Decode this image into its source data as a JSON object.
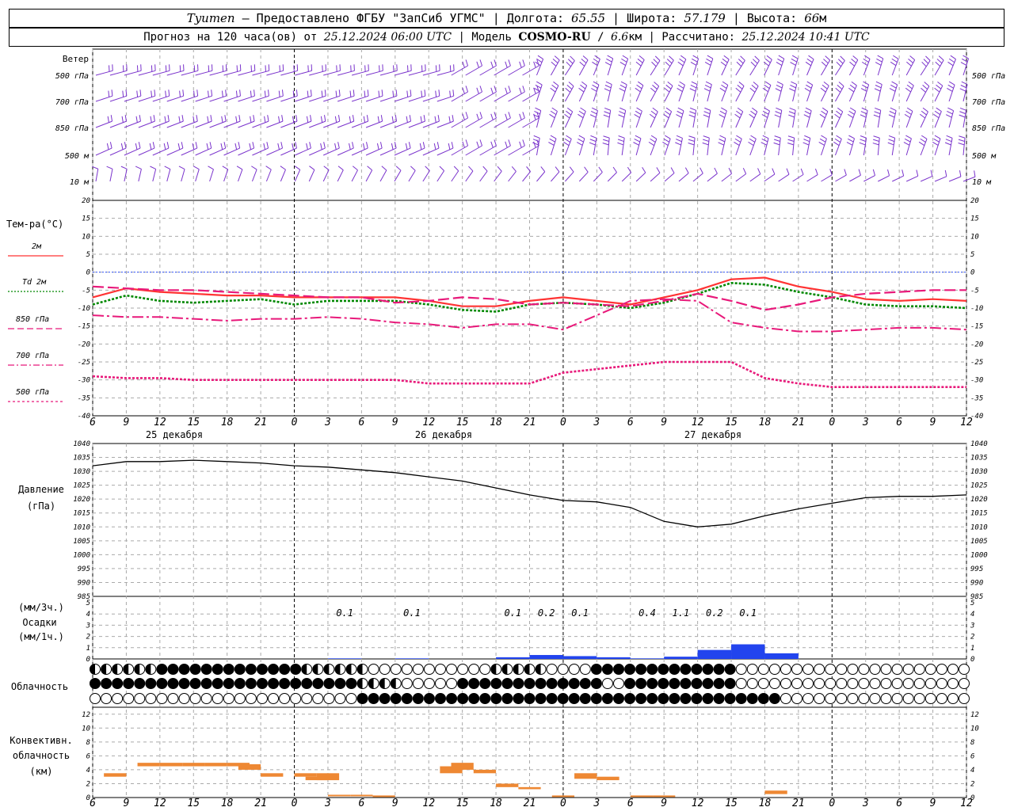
{
  "header": {
    "city": "Tyumen",
    "provider": " – Предоставлено ФГБУ \"ЗапСиб УГМС\" | Долгота: ",
    "lon": "65.55",
    "lat_label": " | Широта: ",
    "lat": "57.179",
    "alt_label": " | Высота: ",
    "alt": "66",
    "alt_unit": "м",
    "forecast_label": "Прогноз на 120 часа(ов) от ",
    "run_time": "25.12.2024 06:00 UTC",
    "model_label": "  | Модель ",
    "model": "COSMO-RU",
    "model_sep": " / ",
    "res": "6.6",
    "res_unit": "км",
    "calc_label": " | Рассчитано: ",
    "calc_time": "25.12.2024 10:41 UTC"
  },
  "wind_panel": {
    "title": "Ветер",
    "levels": [
      "500 гПа",
      "700 гПа",
      "850 гПа",
      "500 м",
      "10  м"
    ],
    "color": "#7a33cc"
  },
  "temp_panel": {
    "title": "Тем-ра(°С)",
    "legend": [
      {
        "label": "2м",
        "color": "#ff3333",
        "style": "solid"
      },
      {
        "label": "Td  2м",
        "color": "#008800",
        "style": "dotted"
      },
      {
        "label": "850 гПа",
        "color": "#e8197a",
        "style": "dash"
      },
      {
        "label": "700 гПа",
        "color": "#e8197a",
        "style": "dashdot"
      },
      {
        "label": "500 гПа",
        "color": "#e8197a",
        "style": "dot"
      }
    ],
    "ticks": [
      "20",
      "15",
      "10",
      "5",
      "0",
      "-5",
      "-10",
      "-15",
      "-20",
      "-25",
      "-30",
      "-35",
      "-40"
    ]
  },
  "time_axis": {
    "hours": [
      "6",
      "9",
      "12",
      "15",
      "18",
      "21",
      "0",
      "3",
      "6",
      "9",
      "12",
      "15",
      "18",
      "21",
      "0",
      "3",
      "6",
      "9",
      "12",
      "15",
      "18",
      "21",
      "0",
      "3",
      "6",
      "9",
      "12"
    ],
    "days": [
      "25 декабря",
      "26 декабря",
      "27 декабря"
    ]
  },
  "pressure_panel": {
    "title": "Давление",
    "unit": "(гПа)",
    "ticks": [
      "1040",
      "1035",
      "1030",
      "1025",
      "1020",
      "1015",
      "1010",
      "1005",
      "1000",
      "995",
      "990",
      "985"
    ]
  },
  "precip_panel": {
    "title1": "(мм/3ч.)",
    "title2": "Осадки",
    "title3": "(мм/1ч.)",
    "ticks": [
      "5",
      "4",
      "3",
      "2",
      "1",
      "0"
    ],
    "labels": [
      "0.1",
      "0.1",
      "0.1",
      "0.2",
      "0.1",
      "0.4",
      "1.1",
      "0.2",
      "0.1"
    ],
    "color": "#2244ee"
  },
  "cloud_panel": {
    "title": "Облачность"
  },
  "conv_panel": {
    "title1": "Конвективн.",
    "title2": "облачность",
    "title3": "(км)",
    "ticks": [
      "12",
      "10",
      "8",
      "6",
      "4",
      "2",
      "0"
    ],
    "color": "#ee8833"
  },
  "chart_data": [
    {
      "type": "line",
      "title": "Тем-ра(°С)",
      "x_hours_from_start": [
        0,
        3,
        6,
        9,
        12,
        15,
        18,
        21,
        24,
        27,
        30,
        33,
        36,
        39,
        42,
        45,
        48,
        51,
        54,
        57,
        60,
        63,
        66,
        69,
        72,
        75,
        78
      ],
      "ylim": [
        -40,
        20
      ],
      "series": [
        {
          "name": "2м",
          "values": [
            -7,
            -4.5,
            -5.5,
            -6,
            -6.5,
            -6.5,
            -7,
            -7,
            -7,
            -7,
            -8,
            -9.5,
            -9.5,
            -8,
            -7,
            -8,
            -9,
            -7,
            -5,
            -2,
            -1.5,
            -4,
            -5.5,
            -7.5,
            -8,
            -7.5,
            -8
          ]
        },
        {
          "name": "Td 2м",
          "values": [
            -9,
            -6.5,
            -8,
            -8.5,
            -8,
            -7.5,
            -9,
            -8,
            -8,
            -8,
            -9,
            -10.5,
            -11,
            -9,
            -8.5,
            -9,
            -10,
            -8.5,
            -6,
            -3,
            -3.5,
            -5.5,
            -7,
            -9,
            -9.5,
            -9.5,
            -10
          ]
        },
        {
          "name": "850 гПа",
          "values": [
            -4,
            -4.5,
            -5,
            -5,
            -5.5,
            -6,
            -6.5,
            -7,
            -7,
            -8.5,
            -8,
            -7,
            -7.5,
            -9,
            -8.5,
            -9,
            -9.5,
            -8,
            -6,
            -8,
            -10.5,
            -9,
            -7,
            -6,
            -5.5,
            -5,
            -5
          ]
        },
        {
          "name": "700 гПа",
          "values": [
            -12,
            -12.5,
            -12.5,
            -13,
            -13.5,
            -13,
            -13,
            -12.5,
            -13,
            -14,
            -14.5,
            -15.5,
            -14.5,
            -14.5,
            -16,
            -12,
            -8,
            -7.5,
            -8,
            -14,
            -15.5,
            -16.5,
            -16.5,
            -16,
            -15.5,
            -15.5,
            -16
          ]
        },
        {
          "name": "500 гПа",
          "values": [
            -29,
            -29.5,
            -29.5,
            -30,
            -30,
            -30,
            -30,
            -30,
            -30,
            -30,
            -31,
            -31,
            -31,
            -31,
            -28,
            -27,
            -26,
            -25,
            -25,
            -25,
            -29.5,
            -31,
            -32,
            -32,
            -32,
            -32,
            -32
          ]
        }
      ]
    },
    {
      "type": "line",
      "title": "Давление",
      "x_hours_from_start": [
        0,
        3,
        6,
        9,
        12,
        15,
        18,
        21,
        24,
        27,
        30,
        33,
        36,
        39,
        42,
        45,
        48,
        51,
        54,
        57,
        60,
        63,
        66,
        69,
        72,
        75,
        78
      ],
      "ylim": [
        985,
        1040
      ],
      "series": [
        {
          "name": "Давление",
          "values": [
            1032,
            1033.5,
            1033.5,
            1034,
            1033.5,
            1033,
            1032,
            1031.5,
            1030.5,
            1029.5,
            1028,
            1026.5,
            1024,
            1021.5,
            1019.5,
            1019,
            1017,
            1012,
            1010,
            1011,
            1014,
            1016.5,
            1018.5,
            1020.5,
            1021,
            1021,
            1021.5
          ]
        }
      ]
    },
    {
      "type": "bar",
      "title": "Осадки",
      "x_hours_from_start": [
        21,
        27,
        36,
        39,
        42,
        45,
        48,
        51,
        54,
        57,
        60
      ],
      "ylim": [
        0,
        5
      ],
      "series": [
        {
          "name": "мм/1ч.",
          "values": [
            0.05,
            0.05,
            0.15,
            0.35,
            0.25,
            0.15,
            0.05,
            0.2,
            0.8,
            1.3,
            0.5
          ]
        }
      ]
    },
    {
      "type": "bar",
      "title": "Конвективн. облачность",
      "x_hours_from_start": [
        1,
        4,
        6,
        8,
        10,
        12,
        13,
        15,
        18,
        19,
        20,
        21,
        23,
        25,
        31,
        32,
        34,
        36,
        38,
        41,
        43,
        45,
        48,
        50,
        60
      ],
      "ylim": [
        0,
        12
      ],
      "series": [
        {
          "name": "bottom",
          "values": [
            3,
            4.5,
            4.5,
            4.5,
            4.5,
            4.5,
            4,
            3,
            3,
            2.5,
            2.5,
            0.2,
            0.2,
            0.1,
            3.5,
            4,
            3.5,
            1.5,
            1.2,
            0.1,
            2.7,
            2.5,
            0.1,
            0.1,
            0.5
          ]
        },
        {
          "name": "top",
          "values": [
            3.5,
            5,
            5,
            5,
            5,
            5,
            4.8,
            3.5,
            3.5,
            3,
            3.5,
            0.4,
            0.4,
            0.3,
            4.5,
            5,
            4,
            2,
            1.5,
            0.3,
            3.5,
            3,
            0.3,
            0.3,
            1
          ]
        }
      ]
    }
  ]
}
